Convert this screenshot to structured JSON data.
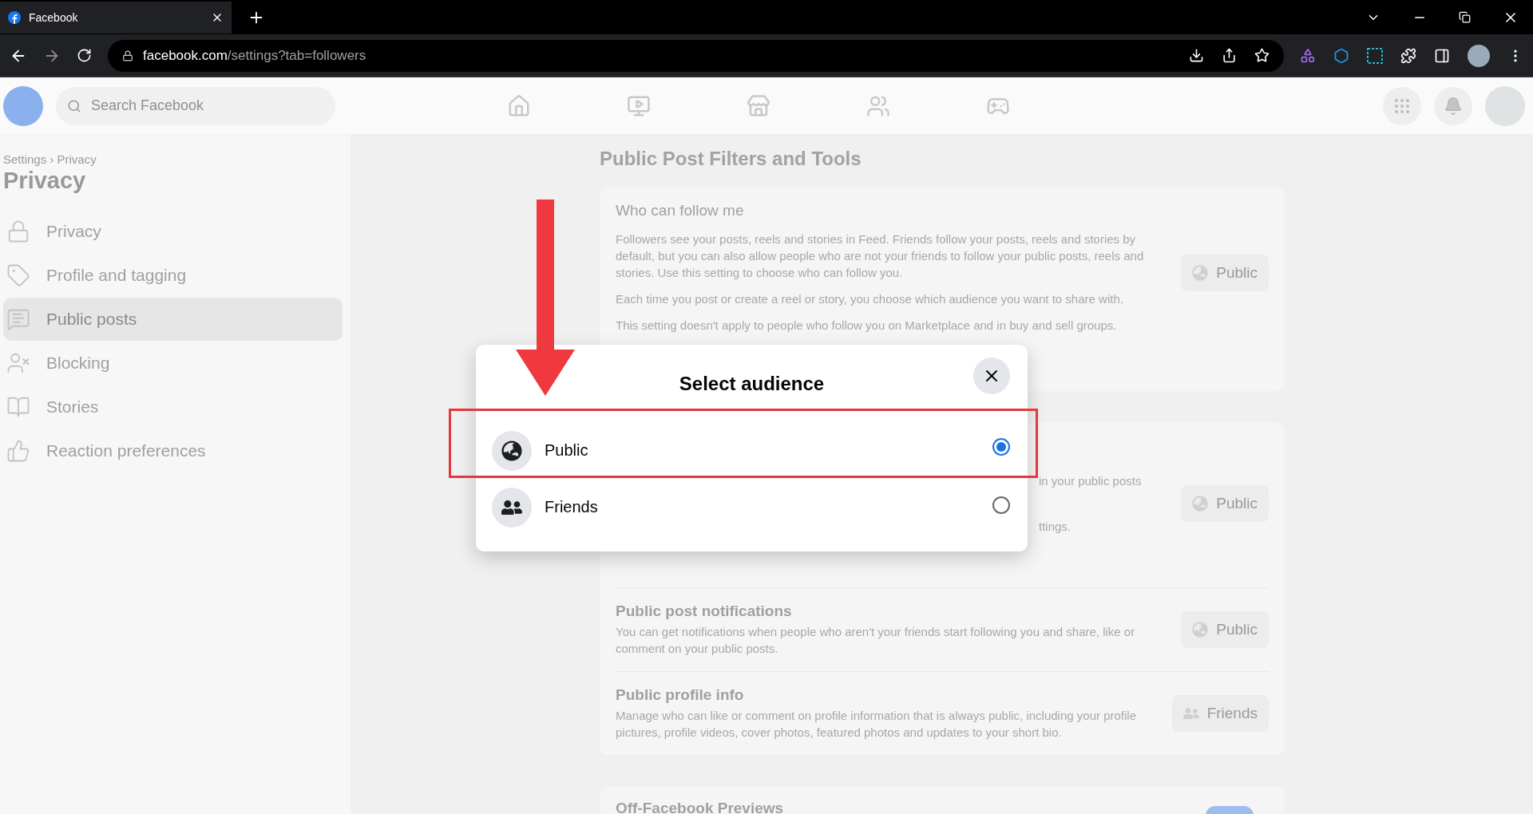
{
  "browser": {
    "tab_title": "Facebook",
    "url_host": "facebook.com",
    "url_path": "/settings?tab=followers"
  },
  "header": {
    "search": {
      "placeholder": "Search Facebook"
    }
  },
  "sidebar": {
    "breadcrumb": "Settings › Privacy",
    "title": "Privacy",
    "items": [
      {
        "label": "Privacy",
        "kind": "lock",
        "selected": false
      },
      {
        "label": "Profile and tagging",
        "kind": "tag",
        "selected": false
      },
      {
        "label": "Public posts",
        "kind": "posts",
        "selected": true
      },
      {
        "label": "Blocking",
        "kind": "block",
        "selected": false
      },
      {
        "label": "Stories",
        "kind": "book",
        "selected": false
      },
      {
        "label": "Reaction preferences",
        "kind": "reaction",
        "selected": false
      }
    ]
  },
  "main": {
    "heading": "Public Post Filters and Tools",
    "who_can_follow": {
      "title": "Who can follow me",
      "paragraphs": [
        "Followers see your posts, reels and stories in Feed. Friends follow your posts, reels and stories by default, but you can also allow people who are not your friends to follow your public posts, reels and stories. Use this setting to choose who can follow you.",
        "Each time you post or create a reel or story, you choose which audience you want to share with.",
        "This setting doesn't apply to people who follow you on Marketplace and in buy and sell groups."
      ],
      "button": {
        "label": "Public",
        "kind": "globe"
      }
    },
    "settings": [
      {
        "kind": "covered",
        "fragments": [
          "in your public posts",
          "ttings."
        ],
        "button": {
          "label": "Public",
          "kind": "globe"
        }
      },
      {
        "kind": "full",
        "title": "Public post notifications",
        "description": "You can get notifications when people who aren't your friends start following you and share, like or comment on your public posts.",
        "button": {
          "label": "Public",
          "kind": "globe"
        }
      },
      {
        "kind": "full",
        "title": "Public profile info",
        "description": "Manage who can like or comment on profile information that is always public, including your profile pictures, profile videos, cover photos, featured photos and updates to your short bio.",
        "button": {
          "label": "Friends",
          "kind": "friends"
        }
      }
    ],
    "next_card": {
      "title": "Off-Facebook Previews",
      "on": true
    }
  },
  "dialog": {
    "title": "Select audience",
    "options": [
      {
        "label": "Public",
        "kind": "globe",
        "selected": true
      },
      {
        "label": "Friends",
        "kind": "friends",
        "selected": false
      }
    ]
  }
}
